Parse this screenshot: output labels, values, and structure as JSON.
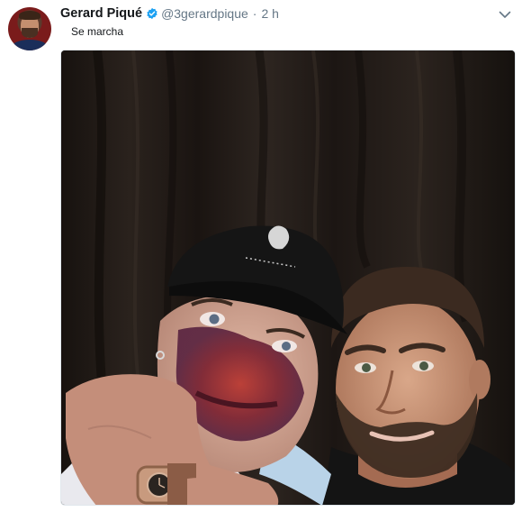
{
  "tweet": {
    "display_name": "Gerard Piqué",
    "handle": "@3gerardpique",
    "separator": "·",
    "time": "2 h",
    "text": "Se marcha",
    "verified": true
  },
  "icons": {
    "avatar": "user-avatar",
    "verified": "verified-badge-icon",
    "menu": "chevron-down-icon",
    "media": "photo"
  },
  "colors": {
    "verified": "#1da1f2",
    "secondary_text": "#657786",
    "primary_text": "#14171a"
  }
}
